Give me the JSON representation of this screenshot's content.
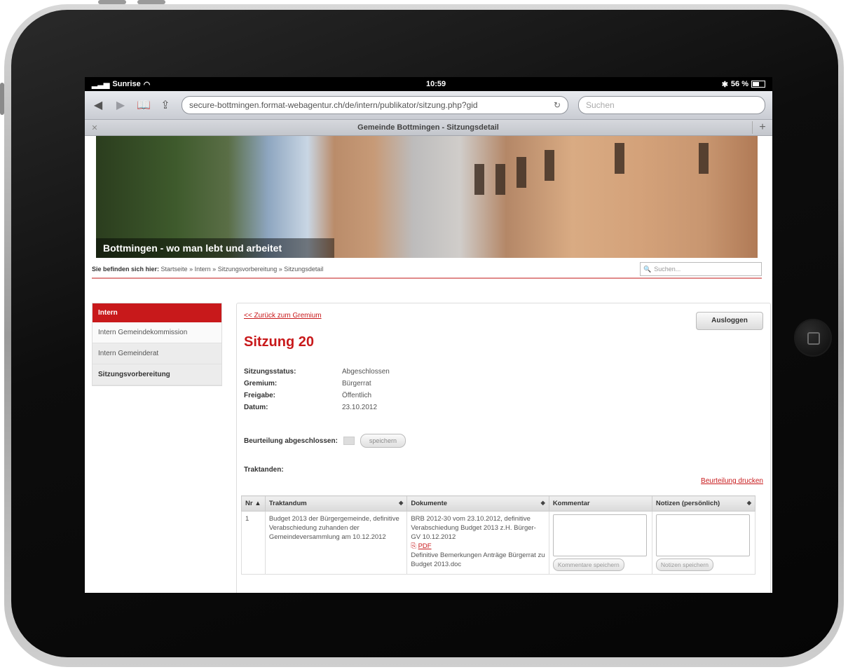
{
  "statusbar": {
    "carrier": "Sunrise",
    "time": "10:59",
    "battery": "56 %"
  },
  "browser": {
    "url": "secure-bottmingen.format-webagentur.ch/de/intern/publikator/sitzung.php?gid",
    "search_placeholder": "Suchen",
    "tab_title": "Gemeinde Bottmingen - Sitzungsdetail"
  },
  "banner": {
    "caption": "Bottmingen - wo man lebt und arbeitet"
  },
  "breadcrumb": {
    "prefix": "Sie befinden sich hier:",
    "items": [
      "Startseite",
      "Intern",
      "Sitzungsvorbereitung",
      "Sitzungsdetail"
    ],
    "separator": "»"
  },
  "site_search": {
    "placeholder": "Suchen..."
  },
  "sidebar": {
    "header": "Intern",
    "items": [
      {
        "label": "Intern Gemeindekommission"
      },
      {
        "label": "Intern Gemeinderat"
      },
      {
        "label": "Sitzungsvorbereitung"
      }
    ]
  },
  "content": {
    "back_link": "<< Zurück zum Gremium",
    "logout": "Ausloggen",
    "title": "Sitzung 20",
    "info": [
      {
        "key": "Sitzungsstatus:",
        "value": "Abgeschlossen"
      },
      {
        "key": "Gremium:",
        "value": "Bürgerrat"
      },
      {
        "key": "Freigabe:",
        "value": "Öffentlich"
      },
      {
        "key": "Datum:",
        "value": "23.10.2012"
      }
    ],
    "assessment_label": "Beurteilung abgeschlossen:",
    "save": "speichern",
    "traktanden_label": "Traktanden:",
    "print_link": "Beurteilung drucken"
  },
  "table": {
    "headers": [
      "Nr",
      "Traktandum",
      "Dokumente",
      "Kommentar",
      "Notizen (persönlich)"
    ],
    "rows": [
      {
        "nr": "1",
        "traktandum": "Budget 2013 der Bürgergemeinde, definitive Verabschiedung zuhanden der Gemeindeversammlung am 10.12.2012",
        "doc1": "BRB 2012-30 vom 23.10.2012, definitive Verabschiedung Budget 2013 z.H. Bürger-GV 10.12.2012",
        "pdf": "PDF",
        "doc2": "Definitive Bemerkungen Anträge Bürgerrat zu Budget 2013.doc",
        "comment_btn": "Kommentare speichern",
        "notes_btn": "Notizen speichern"
      }
    ]
  }
}
